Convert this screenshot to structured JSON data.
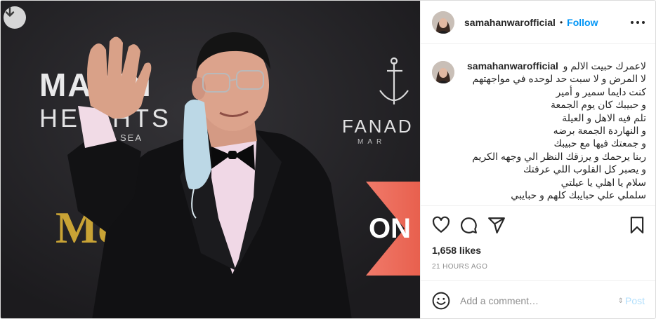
{
  "media": {
    "sign_left_line1": "MAADI",
    "sign_left_line2": "HEIGHTS",
    "sign_left_line3": "SEA",
    "sign_right": "FANAD",
    "sign_right_sub": "MAR",
    "sign_mega": "Mega",
    "sign_on": "ON",
    "download_icon": "download-arrow-icon"
  },
  "post": {
    "username": "samahanwarofficial",
    "separator": "•",
    "follow_label": "Follow",
    "more_icon": "more-horizontal-icon",
    "caption_first": "لاعمرك حبيت الالم و",
    "caption_lines": [
      "لا المرض و لا سبت حد لوحده في مواجهتهم",
      "كنت دايما سمير و أمير",
      "و حبيبك كان يوم الجمعة",
      "تلم فيه الاهل و العيلة",
      "و النهاردة الجمعة برضه",
      "و جمعتك فيها مع حبيبك",
      "ربنا يرحمك و يرزقك النظر الي وجهه الكريم",
      "و يصبر كل القلوب اللي عرفتك",
      "سلام يا اهلي يا عيلتي",
      "سلملي علي حبايبك كلهم و حبايبي"
    ],
    "likes": "1,658 likes",
    "time_ago": "21 HOURS AGO",
    "comment_placeholder": "Add a comment…",
    "post_label": "Post",
    "accent": "#0095f6"
  }
}
